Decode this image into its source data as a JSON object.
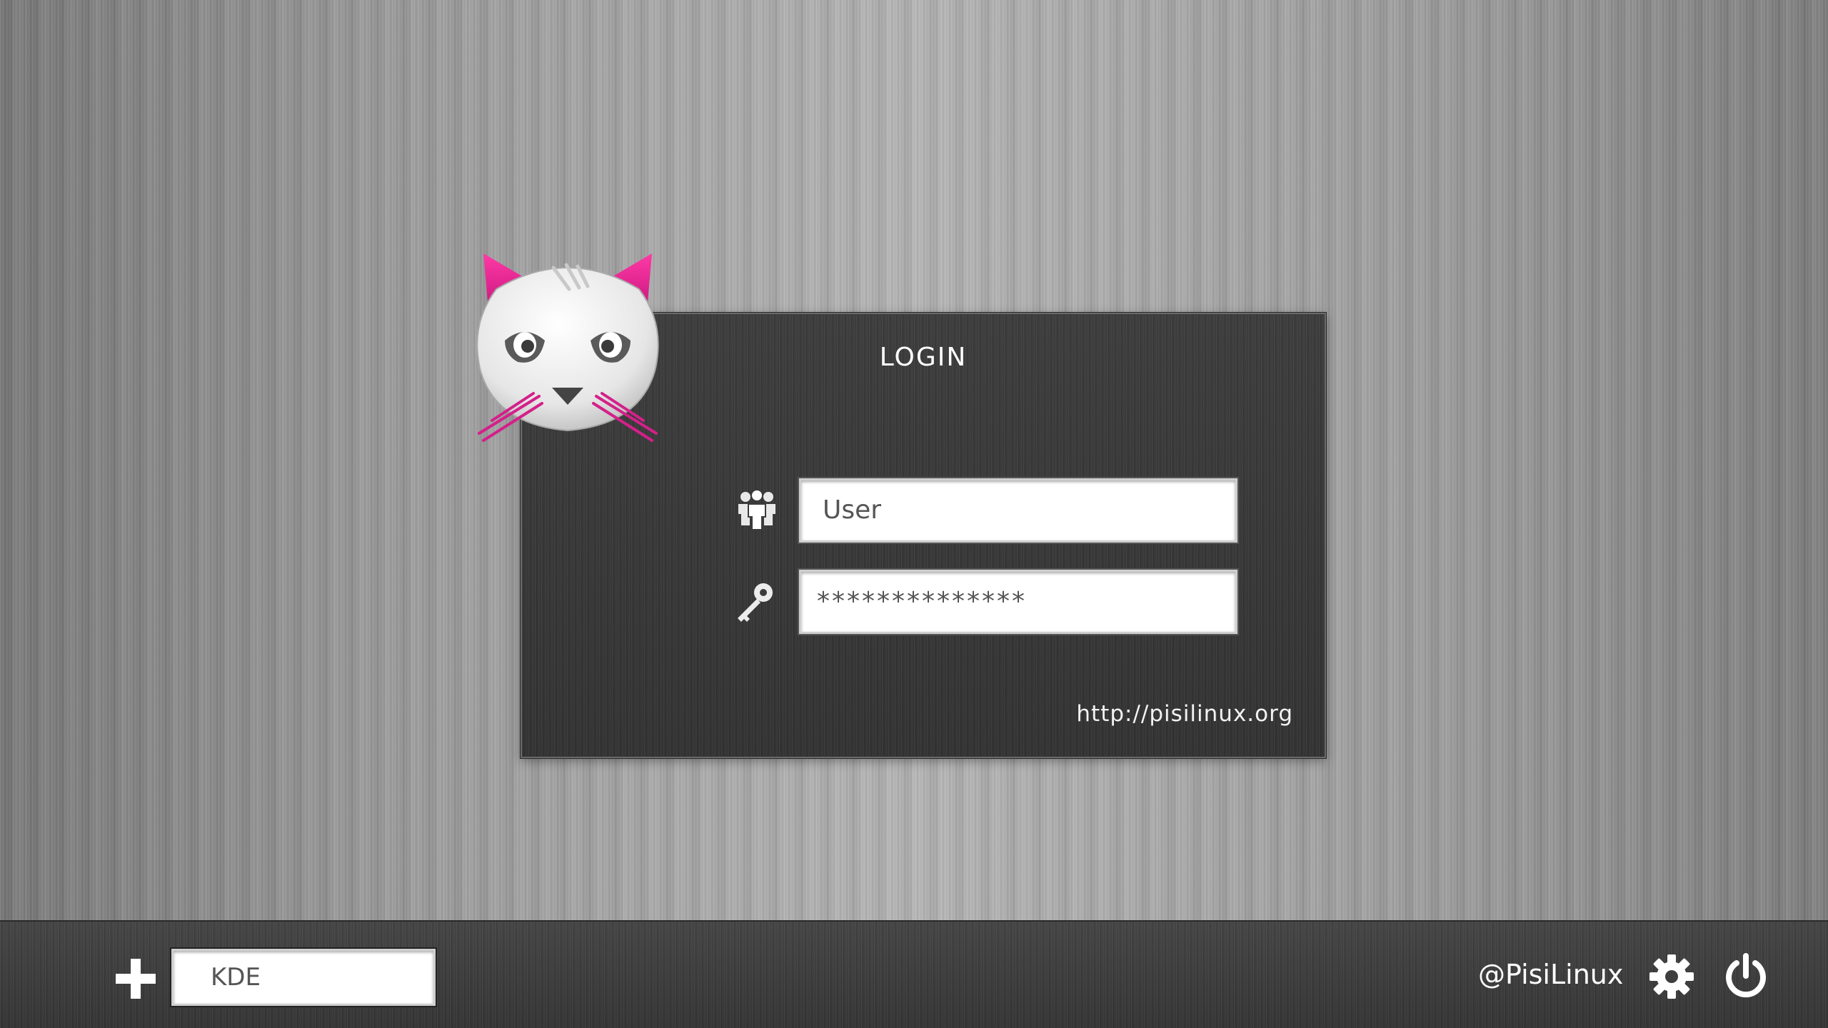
{
  "login": {
    "title": "LOGIN",
    "username": {
      "icon": "users-icon",
      "placeholder": "User",
      "value": ""
    },
    "password": {
      "icon": "key-icon",
      "value": "**************"
    },
    "website": "http://pisilinux.org"
  },
  "logo": {
    "icon": "pisi-cat-logo",
    "accent_color": "#e0208c"
  },
  "bottom_bar": {
    "add_icon": "plus-icon",
    "session": "KDE",
    "handle": "@PisiLinux",
    "settings_icon": "gear-icon",
    "power_icon": "power-icon"
  }
}
